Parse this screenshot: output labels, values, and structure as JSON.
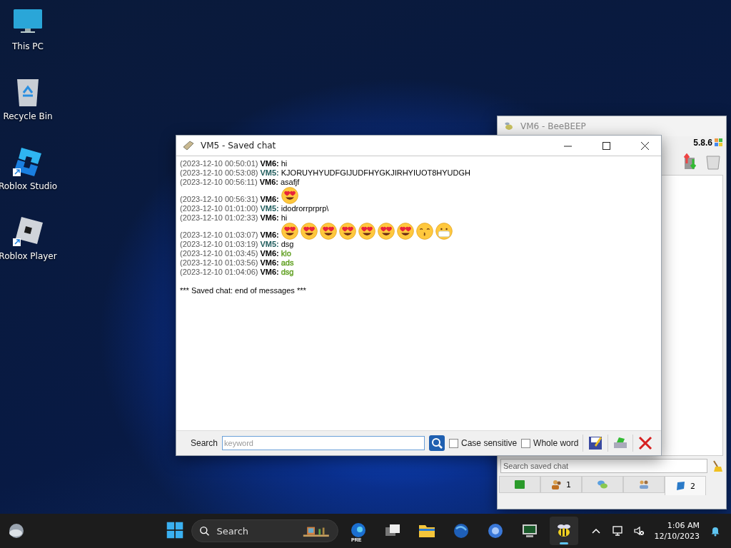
{
  "desktop_icons": [
    {
      "kind": "pc",
      "label": "This PC"
    },
    {
      "kind": "bin",
      "label": "Recycle Bin"
    },
    {
      "kind": "studio",
      "label": "Roblox Studio"
    },
    {
      "kind": "player",
      "label": "Roblox Player"
    }
  ],
  "background_window": {
    "title": "VM6 - BeeBEEP",
    "version": "5.8.6",
    "search": {
      "placeholder": "Search saved chat"
    },
    "tabs": [
      {
        "kind": "screen",
        "selected": false
      },
      {
        "kind": "users",
        "count": "1",
        "selected": false
      },
      {
        "kind": "chat",
        "selected": false
      },
      {
        "kind": "groups",
        "selected": false
      },
      {
        "kind": "saved",
        "count": "2",
        "selected": true
      }
    ]
  },
  "chat_window": {
    "title": "VM5 - Saved chat",
    "messages": [
      {
        "time": "(2023-12-10 00:50:01)",
        "sender": {
          "name": "VM6:",
          "color": "#000000"
        },
        "text": "hi"
      },
      {
        "time": "(2023-12-10 00:53:08)",
        "sender": {
          "name": "VM5:",
          "color": "#1f5c5c"
        },
        "text": "KJORUYHYUDFGIJUDFHYGKJIRHYIUOT8HYUDGH"
      },
      {
        "time": "(2023-12-10 00:56:11)",
        "sender": {
          "name": "VM6:",
          "color": "#000000"
        },
        "text": "asafjf"
      },
      {
        "time": "(2023-12-10 00:56:31)",
        "sender": {
          "name": "VM6:",
          "color": "#000000"
        },
        "emojis": [
          {
            "kind": "heart-eyes"
          }
        ]
      },
      {
        "time": "(2023-12-10 01:01:00)",
        "sender": {
          "name": "VM5:",
          "color": "#1f5c5c"
        },
        "text": "idodrorrprprp\\"
      },
      {
        "time": "(2023-12-10 01:02:33)",
        "sender": {
          "name": "VM6:",
          "color": "#000000"
        },
        "text": "hi"
      },
      {
        "time": "(2023-12-10 01:03:07)",
        "sender": {
          "name": "VM6:",
          "color": "#000000"
        },
        "emojis": [
          {
            "kind": "heart-eyes"
          },
          {
            "kind": "heart-eyes"
          },
          {
            "kind": "heart-eyes"
          },
          {
            "kind": "heart-eyes"
          },
          {
            "kind": "heart-eyes"
          },
          {
            "kind": "heart-eyes"
          },
          {
            "kind": "heart-eyes"
          },
          {
            "kind": "kissing"
          },
          {
            "kind": "mask"
          }
        ]
      },
      {
        "time": "(2023-12-10 01:03:19)",
        "sender": {
          "name": "VM5:",
          "color": "#1f5c5c"
        },
        "text": "dsg"
      },
      {
        "time": "(2023-12-10 01:03:45)",
        "sender": {
          "name": "VM6:",
          "color": "#000000"
        },
        "text": "klo",
        "color": "#5f9f1f"
      },
      {
        "time": "(2023-12-10 01:03:56)",
        "sender": {
          "name": "VM6:",
          "color": "#000000"
        },
        "text": "ads",
        "color": "#5f9f1f"
      },
      {
        "time": "(2023-12-10 01:04:06)",
        "sender": {
          "name": "VM6:",
          "color": "#000000"
        },
        "text": "dsg",
        "color": "#5f9f1f"
      }
    ],
    "end_note": "*** Saved chat: end of messages ***",
    "search_bar": {
      "label": "Search",
      "placeholder": "keyword",
      "case_sensitive": {
        "label": "Case sensitive",
        "checked": false
      },
      "whole_word": {
        "label": "Whole word",
        "checked": false
      }
    }
  },
  "taskbar": {
    "search": {
      "placeholder": "Search"
    },
    "apps": [
      {
        "kind": "edge",
        "badge": "PRE",
        "selected": false
      },
      {
        "kind": "taskview",
        "selected": false
      },
      {
        "kind": "folder",
        "selected": false
      },
      {
        "kind": "globe",
        "selected": false
      },
      {
        "kind": "ring",
        "selected": false
      },
      {
        "kind": "monitor",
        "selected": false
      },
      {
        "kind": "bee",
        "selected": true
      }
    ],
    "time": "1:06 AM",
    "date": "12/10/2023"
  }
}
